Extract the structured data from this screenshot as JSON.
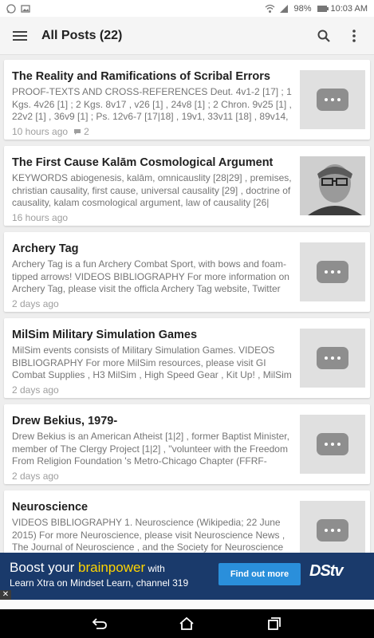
{
  "status_bar": {
    "battery": "98%",
    "time": "10:03 AM"
  },
  "app_bar": {
    "title": "All Posts (22)",
    "menu_icon": "menu-icon",
    "search_icon": "search-icon",
    "overflow_icon": "more-vert-icon"
  },
  "posts": [
    {
      "title": "The Reality and Ramifications of Scribal Errors",
      "excerpt": "PROOF-TEXTS AND CROSS-REFERENCES Deut. 4v1-2 [17] ; 1 Kgs. 4v26 [1] ; 2 Kgs. 8v17 , v26 [1] , 24v8 [1] ; 2 Chron. 9v25 [1] , 22v2 [1] , 36v9 [1] ; Ps. 12v6-7 [17|18] , 19v1, 33v11 [18] , 89v14,",
      "time": "10 hours ago",
      "comments": "2",
      "thumb": "placeholder"
    },
    {
      "title": "The First Cause Kalām Cosmological Argument",
      "excerpt": "KEYWORDS abiogenesis, kalām, omnicauslity [28|29] , premises, christian causality, first cause, universal causality [29] , doctrine of causality, kalam cosmological argument, law of causality [26|",
      "time": "16 hours ago",
      "comments": "",
      "thumb": "photo"
    },
    {
      "title": "Archery Tag",
      "excerpt": "Archery Tag is a fun Archery Combat Sport, with bows and foam-tipped arrows! VIDEOS BIBLIOGRAPHY For more information on Archery Tag, please visit the officla Archery Tag website, Twitter",
      "time": "2 days ago",
      "comments": "",
      "thumb": "placeholder"
    },
    {
      "title": "MilSim Military Simulation Games",
      "excerpt": "MilSim events consists of Military Simulation Games. VIDEOS BIBLIOGRAPHY For more MilSim resources, please visit GI Combat Supplies , H3 MilSim , High Speed Gear , Kit Up! , MilSim",
      "time": "2 days ago",
      "comments": "",
      "thumb": "placeholder"
    },
    {
      "title": "Drew Bekius, 1979-",
      "excerpt": "Drew Bekius is an American Atheist [1|2] , former Baptist Minister, member of The Clergy Project [1|2] , \"volunteer with the Freedom From Religion Foundation 's Metro-Chicago Chapter (FFRF-",
      "time": "2 days ago",
      "comments": "",
      "thumb": "placeholder"
    },
    {
      "title": "Neuroscience",
      "excerpt": "VIDEOS BIBLIOGRAPHY 1. Neuroscience (Wikipedia; 22 June 2015) For more Neuroscience, please visit Neuroscience News , The Journal of Neuroscience , and the Society for Neuroscience",
      "time": "",
      "comments": "",
      "thumb": "placeholder"
    }
  ],
  "ad": {
    "headline_pre": "Boost your ",
    "headline_accent": "brainpower",
    "headline_post": " with",
    "line2": "Learn Xtra on Mindset Learn, channel 319",
    "cta": "Find out more",
    "logo": "DStv",
    "close": "✕"
  },
  "nav": {
    "back": "back-icon",
    "home": "home-icon",
    "recents": "recents-icon"
  },
  "colors": {
    "ad_bg": "#1a3a6b",
    "ad_accent": "#ffd400",
    "ad_cta": "#2a8fdb"
  }
}
